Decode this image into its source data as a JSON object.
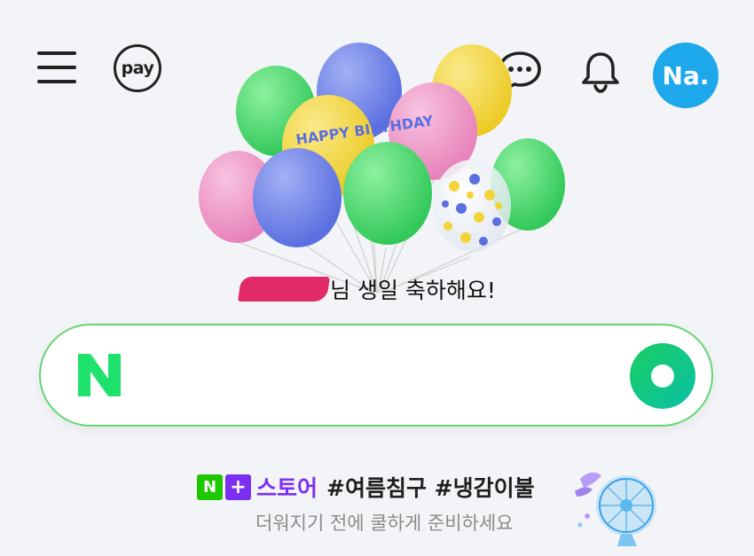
{
  "header": {
    "menu_icon": "hamburger-menu-icon",
    "pay_label": "pay",
    "chat_icon": "chat-bubble-icon",
    "bell_icon": "bell-icon",
    "avatar_text": "Na.",
    "avatar_color": "#1da8ec"
  },
  "birthday": {
    "message": "님 생일 축하해요!",
    "balloon_text": "HAPPY BIRTHDAY",
    "balloon_colors": [
      "#3fd66b",
      "#6b7ee6",
      "#f2d438",
      "#ef95c6"
    ]
  },
  "search": {
    "placeholder": "",
    "logo": "N",
    "logo_color": "#1ee26b",
    "border_color": "#63d673",
    "button_icon": "search-circle-icon"
  },
  "promo": {
    "badge_n": "N",
    "badge_plus": "+",
    "store_label": "스토어",
    "tags": "#여름침구 #냉감이불",
    "subtitle": "더워지기 전에 쿨하게 준비하세요",
    "image_icon": "summer-fan-icon",
    "accent_color": "#7b2ff2"
  }
}
